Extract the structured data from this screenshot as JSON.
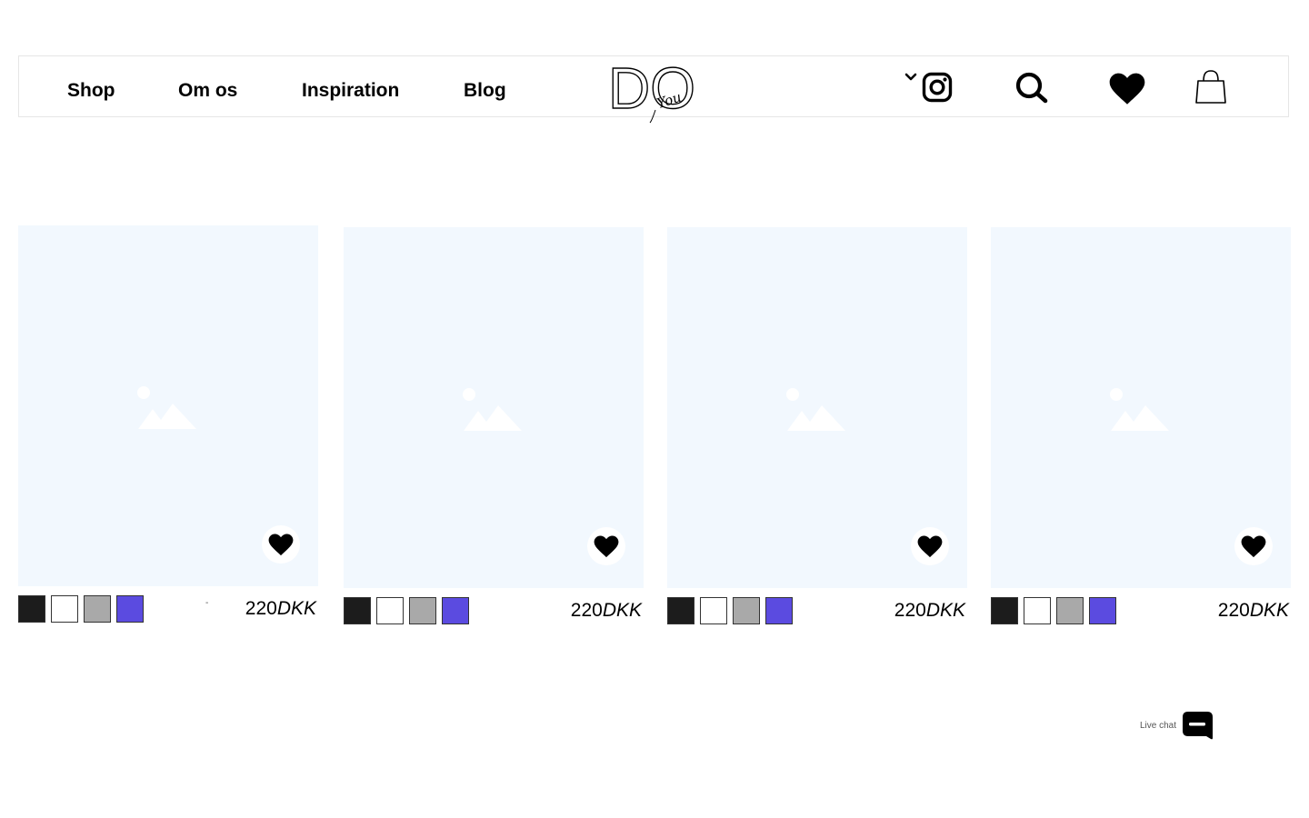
{
  "header": {
    "nav": [
      "Shop",
      "Om os",
      "Inspiration",
      "Blog"
    ],
    "logo_letters": "DO",
    "logo_script": "You",
    "icons": [
      "chevron-down-icon",
      "instagram-icon",
      "search-icon",
      "heart-icon",
      "shopping-bag-icon"
    ]
  },
  "products": [
    {
      "price": "220",
      "currency": "DKK",
      "swatches": [
        "#1c1c1c",
        "#ffffff",
        "#a9a9a9",
        "#5b4be0"
      ]
    },
    {
      "price": "220",
      "currency": "DKK",
      "swatches": [
        "#1c1c1c",
        "#ffffff",
        "#a9a9a9",
        "#5b4be0"
      ]
    },
    {
      "price": "220",
      "currency": "DKK",
      "swatches": [
        "#1c1c1c",
        "#ffffff",
        "#a9a9a9",
        "#5b4be0"
      ]
    },
    {
      "price": "220",
      "currency": "DKK",
      "swatches": [
        "#1c1c1c",
        "#ffffff",
        "#a9a9a9",
        "#5b4be0"
      ]
    }
  ],
  "first_card_mark": "-",
  "chat": {
    "label": "Live chat"
  },
  "colors": {
    "image_placeholder_bg": "#f2f8fe",
    "header_border": "#e6e6e6"
  }
}
